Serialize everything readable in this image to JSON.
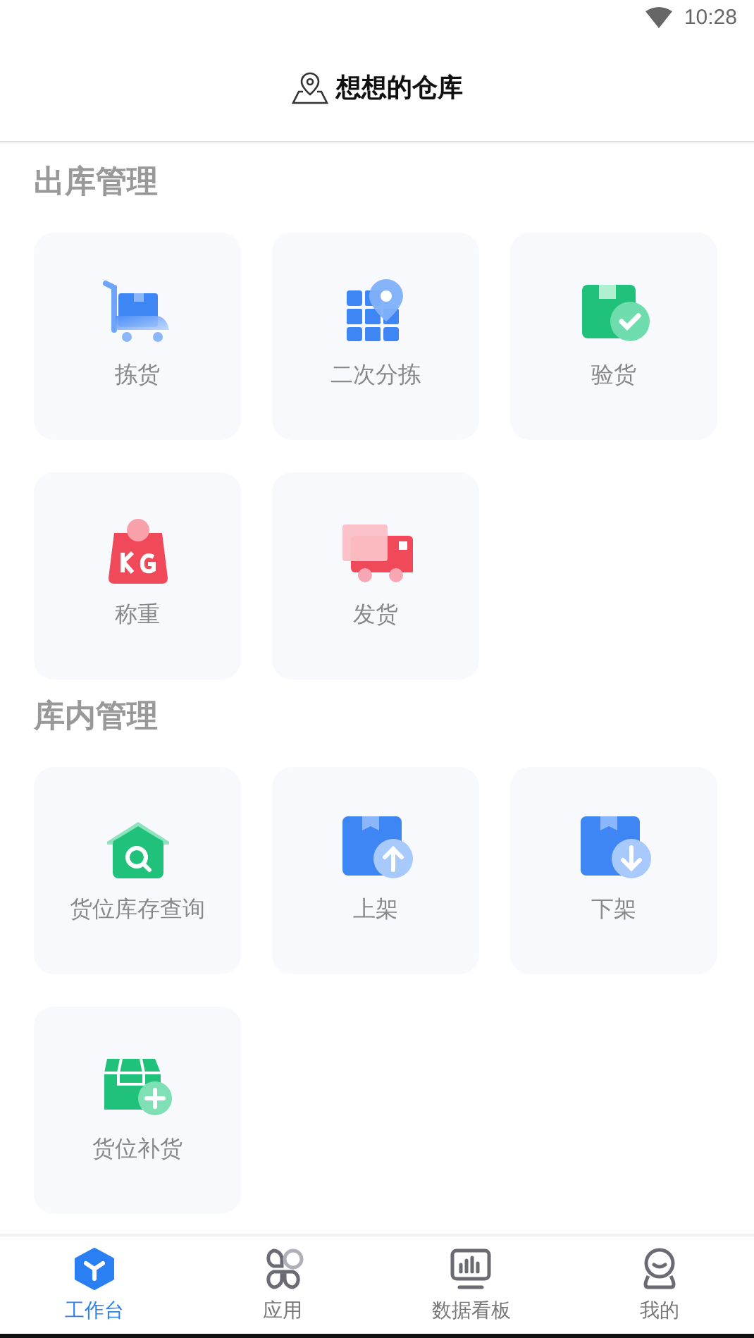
{
  "status_bar": {
    "time": "10:28"
  },
  "header": {
    "title": "想想的仓库"
  },
  "sections": [
    {
      "title": "出库管理",
      "items": [
        {
          "label": "拣货"
        },
        {
          "label": "二次分拣"
        },
        {
          "label": "验货"
        },
        {
          "label": "称重"
        },
        {
          "label": "发货"
        }
      ]
    },
    {
      "title": "库内管理",
      "items": [
        {
          "label": "货位库存查询"
        },
        {
          "label": "上架"
        },
        {
          "label": "下架"
        },
        {
          "label": "货位补货"
        }
      ]
    }
  ],
  "tab_bar": [
    {
      "label": "工作台",
      "selected": true
    },
    {
      "label": "应用",
      "selected": false
    },
    {
      "label": "数据看板",
      "selected": false
    },
    {
      "label": "我的",
      "selected": false
    }
  ]
}
